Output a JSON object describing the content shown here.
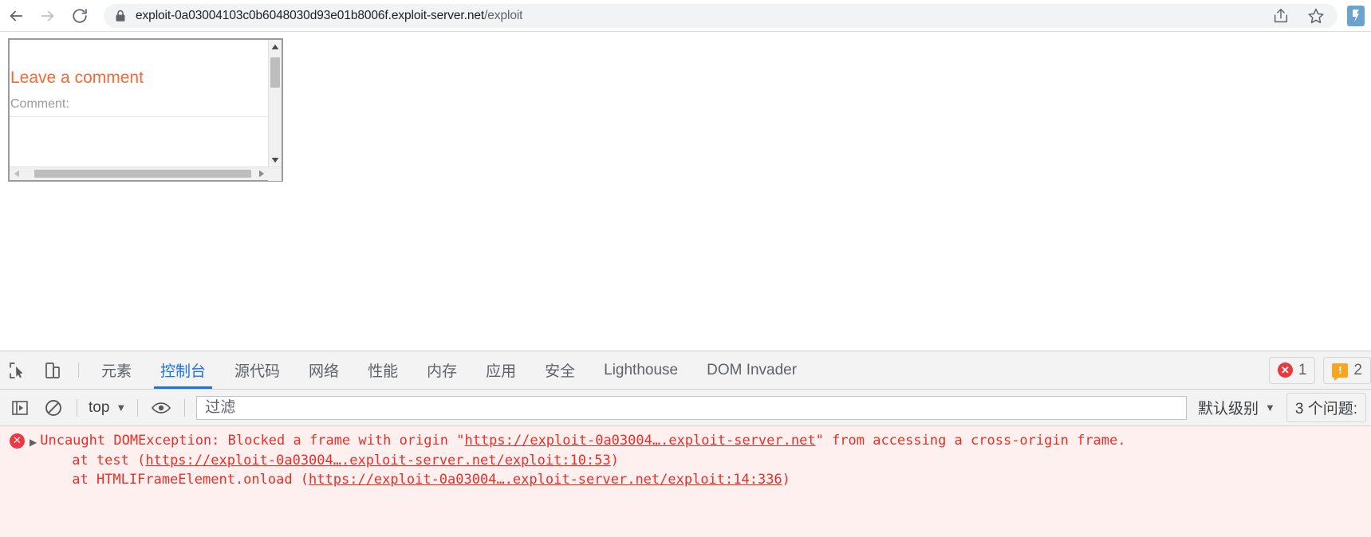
{
  "browser": {
    "back_label": "Back",
    "forward_label": "Forward",
    "reload_label": "Reload",
    "lock_label": "View site information",
    "url_host": "exploit-0a03004103c0b6048030d93e01b8006f.exploit-server.net",
    "url_path": "/exploit",
    "share_label": "Share this page",
    "bookmark_label": "Bookmark this tab",
    "extension_label": "Burp Suite extension"
  },
  "page": {
    "frame": {
      "heading": "Leave a comment",
      "comment_label": "Comment:",
      "comment_value": "",
      "scroll_up_label": "Scroll up",
      "scroll_down_label": "Scroll down",
      "scroll_left_label": "Scroll left",
      "scroll_right_label": "Scroll right"
    }
  },
  "devtools": {
    "inspect_label": "Inspect element",
    "device_toolbar_label": "Toggle device toolbar",
    "tabs": [
      {
        "label": "元素",
        "active": false
      },
      {
        "label": "控制台",
        "active": true
      },
      {
        "label": "源代码",
        "active": false
      },
      {
        "label": "网络",
        "active": false
      },
      {
        "label": "性能",
        "active": false
      },
      {
        "label": "内存",
        "active": false
      },
      {
        "label": "应用",
        "active": false
      },
      {
        "label": "安全",
        "active": false
      },
      {
        "label": "Lighthouse",
        "active": false
      },
      {
        "label": "DOM Invader",
        "active": false
      }
    ],
    "badges": {
      "error_count": "1",
      "error_glyph": "✕",
      "warning_count": "2",
      "warning_glyph": "!"
    },
    "console_toolbar": {
      "sidebar_toggle_label": "Show console sidebar",
      "clear_label": "Clear console",
      "context_value": "top",
      "context_caret": "▼",
      "eye_label": "Create live expression",
      "filter_placeholder": "过滤",
      "filter_value": "",
      "levels_label": "默认级别",
      "levels_caret": "▼",
      "issues_label": "3 个问题:"
    },
    "console_messages": [
      {
        "icon": "error-icon",
        "disclosure": "▶",
        "lines": [
          "Uncaught DOMException: Blocked a frame with origin \"https://exploit-0a03004….exploit-server.net\" from accessing a cross-origin frame.",
          "at test (https://exploit-0a03004….exploit-server.net/exploit:10:53)",
          "at HTMLIFrameElement.onload (https://exploit-0a03004….exploit-server.net/exploit:14:336)"
        ],
        "line1_pre": "Uncaught DOMException: Blocked a frame with origin \"",
        "line1_link": "https://exploit-0a03004….exploit-server.net",
        "line1_post": "\" from accessing a cross-origin frame.",
        "line2_pre": "at test (",
        "line2_link": "https://exploit-0a03004….exploit-server.net/exploit:10:53",
        "line2_post": ")",
        "line3_pre": "at HTMLIFrameElement.onload (",
        "line3_link": "https://exploit-0a03004….exploit-server.net/exploit:14:336",
        "line3_post": ")"
      }
    ]
  },
  "colors": {
    "accent_blue": "#1a73e8",
    "error_red": "#eb3941",
    "warning_orange": "#f5a623",
    "heading_orange": "#ff6633",
    "console_bg": "#fff0f0"
  }
}
